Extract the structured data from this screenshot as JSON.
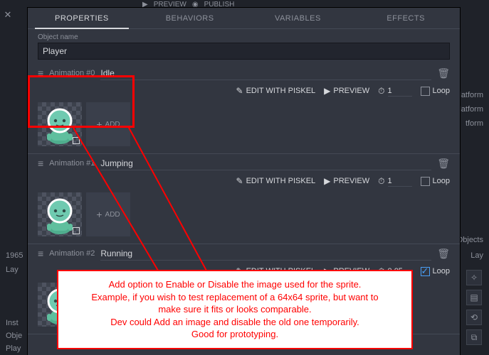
{
  "topbar": {
    "preview": "PREVIEW",
    "publish": "PUBLISH"
  },
  "tabs": {
    "properties": "PROPERTIES",
    "behaviors": "BEHAVIORS",
    "variables": "VARIABLES",
    "effects": "EFFECTS"
  },
  "object_name_label": "Object name",
  "object_name": "Player",
  "controls": {
    "edit": "EDIT WITH PISKEL",
    "preview": "PREVIEW",
    "loop": "Loop",
    "add": "ADD"
  },
  "animations": [
    {
      "index_label": "Animation #0",
      "name": "Idle",
      "time": "1",
      "loop": false,
      "frames": 1
    },
    {
      "index_label": "Animation #1",
      "name": "Jumping",
      "time": "1",
      "loop": false,
      "frames": 1
    },
    {
      "index_label": "Animation #2",
      "name": "Running",
      "time": "0.05",
      "loop": true,
      "frames": 5
    }
  ],
  "annotation": {
    "l1": "Add option to Enable or Disable the image used for the sprite.",
    "l2": "Example, if you wish to test replacement of a 64x64 sprite, but want to",
    "l3": "make sure it fits or looks comparable.",
    "l4": "Dev could Add an image and disable the old one temporarily.",
    "l5": "Good for prototyping."
  },
  "bg": {
    "r1": "latform",
    "r2": "Platform",
    "r3": "tform",
    "r4": "dObjects",
    "r5": "Lay",
    "bl1": "1965",
    "bl2": "Lay",
    "bl3": "Inst",
    "bl4": "Obje",
    "bl5": "Play"
  }
}
